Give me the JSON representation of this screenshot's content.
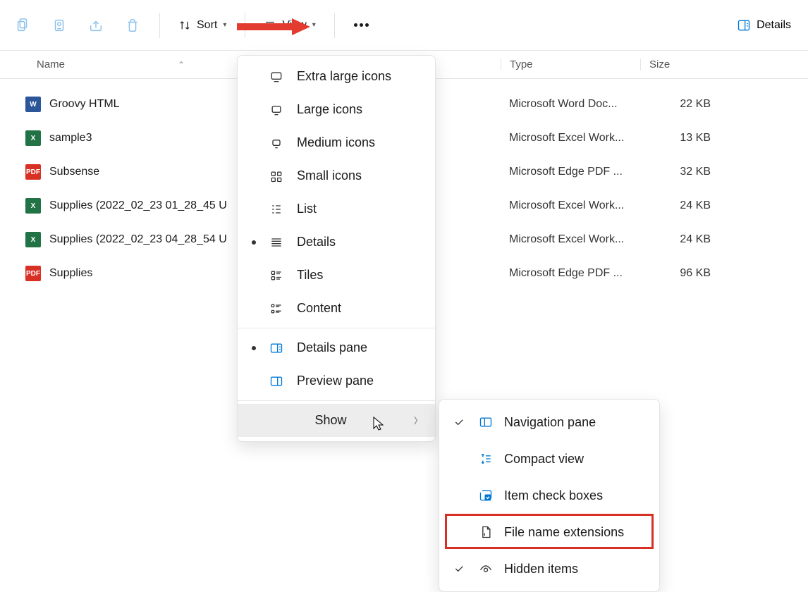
{
  "toolbar": {
    "sort_label": "Sort",
    "view_label": "View",
    "details_label": "Details"
  },
  "columns": {
    "name": "Name",
    "type": "Type",
    "size": "Size"
  },
  "files": [
    {
      "icon": "word",
      "name": "Groovy HTML",
      "type": "Microsoft Word Doc...",
      "size": "22 KB"
    },
    {
      "icon": "excel",
      "name": "sample3",
      "type": "Microsoft Excel Work...",
      "size": "13 KB"
    },
    {
      "icon": "pdf",
      "name": "Subsense",
      "type": "Microsoft Edge PDF ...",
      "size": "32 KB"
    },
    {
      "icon": "excel",
      "name": "Supplies (2022_02_23 01_28_45 U",
      "type": "Microsoft Excel Work...",
      "size": "24 KB"
    },
    {
      "icon": "excel",
      "name": "Supplies (2022_02_23 04_28_54 U",
      "type": "Microsoft Excel Work...",
      "size": "24 KB"
    },
    {
      "icon": "pdf",
      "name": "Supplies",
      "type": "Microsoft Edge PDF ...",
      "size": "96 KB"
    }
  ],
  "view_menu": {
    "extra_large": "Extra large icons",
    "large": "Large icons",
    "medium": "Medium icons",
    "small": "Small icons",
    "list": "List",
    "details": "Details",
    "tiles": "Tiles",
    "content": "Content",
    "details_pane": "Details pane",
    "preview_pane": "Preview pane",
    "show": "Show"
  },
  "show_menu": {
    "navigation_pane": "Navigation pane",
    "compact_view": "Compact view",
    "item_check_boxes": "Item check boxes",
    "file_name_extensions": "File name extensions",
    "hidden_items": "Hidden items"
  }
}
